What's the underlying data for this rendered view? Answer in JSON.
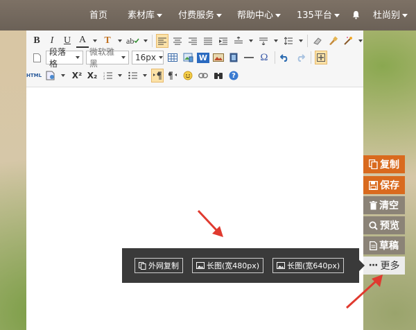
{
  "nav": {
    "items": [
      {
        "label": "首页",
        "caret": false
      },
      {
        "label": "素材库",
        "caret": true
      },
      {
        "label": "付费服务",
        "caret": true
      },
      {
        "label": "帮助中心",
        "caret": true
      },
      {
        "label": "135平台",
        "caret": true
      },
      {
        "label": "杜尚别",
        "caret": true
      }
    ]
  },
  "toolbar": {
    "bold": "B",
    "italic": "I",
    "underline": "U",
    "font_color": "A",
    "bg_color": "T",
    "spell": "ab",
    "format_select": "段落格",
    "font_select": "微软雅黑",
    "size_select": "16px",
    "word_badge": "W",
    "omega": "Ω",
    "html_label": "HTML",
    "superscript": "X²",
    "subscript": "X₂",
    "help": "?"
  },
  "side": {
    "copy": "复制",
    "save": "保存",
    "clear": "清空",
    "preview": "预览",
    "draft": "草稿",
    "more_dots": "···",
    "more": "更多"
  },
  "popup": {
    "ext_copy": "外网复制",
    "long_480": "长图(宽480px)",
    "long_640": "长图(宽640px)"
  },
  "colors": {
    "accent_orange": "#d96a1e",
    "side_grey": "#8b8377",
    "nav_bg": "#756a5f",
    "popup_bg": "#3a3a3a",
    "arrow_red": "#e03a2f"
  }
}
